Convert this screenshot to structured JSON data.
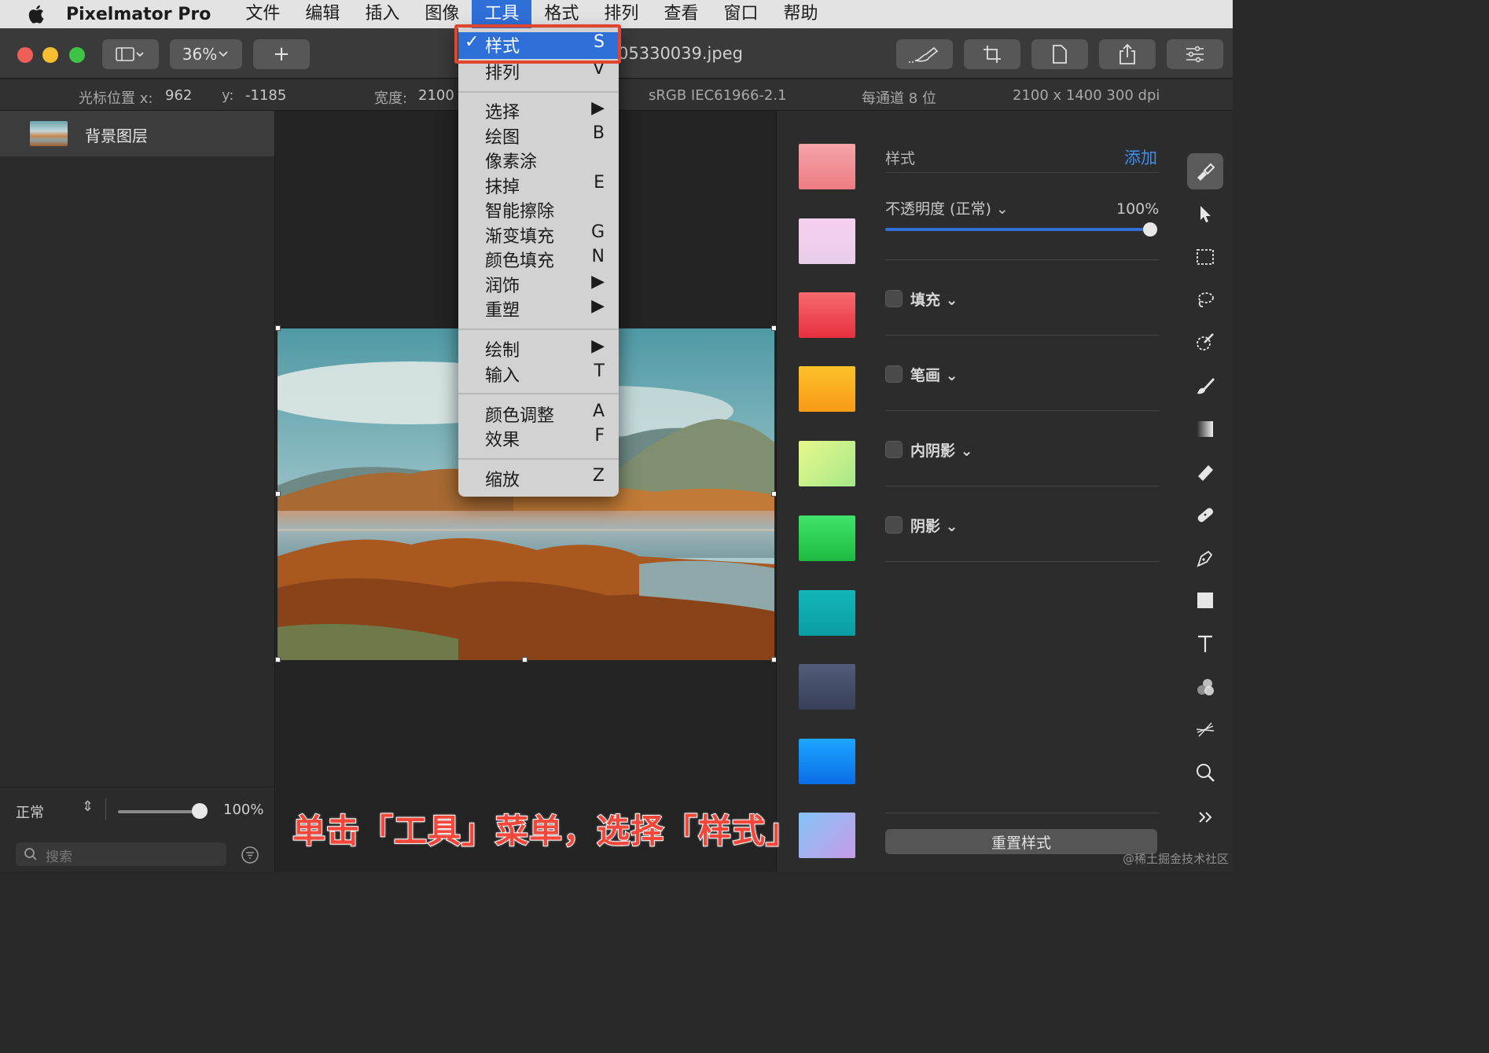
{
  "menubar": {
    "app_name": "Pixelmator Pro",
    "menus": [
      "文件",
      "编辑",
      "插入",
      "图像",
      "工具",
      "格式",
      "排列",
      "查看",
      "窗口",
      "帮助"
    ],
    "active_menu": "工具"
  },
  "toolbar": {
    "zoom": "36%",
    "add_label": "+",
    "doc_title": "05330039.jpeg"
  },
  "infobar": {
    "cursor_x_label": "光标位置 x:",
    "cursor_x": "962",
    "cursor_y_label": "y:",
    "cursor_y": "-1185",
    "width_label": "宽度:",
    "width": "2100",
    "colorspace": "sRGB IEC61966-2.1",
    "bitdepth": "每通道 8 位",
    "dimensions": "2100 x 1400 300 dpi"
  },
  "layers": {
    "items": [
      {
        "name": "背景图层"
      }
    ],
    "blend_mode": "正常",
    "opacity": "100%",
    "search_placeholder": "搜索"
  },
  "tools_menu": {
    "items": [
      {
        "label": "样式",
        "shortcut": "S",
        "checked": "✓"
      },
      {
        "label": "排列",
        "shortcut": "V"
      },
      {
        "label": "选择",
        "shortcut": "▶"
      },
      {
        "label": "绘图",
        "shortcut": "B"
      },
      {
        "label": "像素涂",
        "shortcut": ""
      },
      {
        "label": "抹掉",
        "shortcut": "E"
      },
      {
        "label": "智能擦除",
        "shortcut": ""
      },
      {
        "label": "渐变填充",
        "shortcut": "G"
      },
      {
        "label": "颜色填充",
        "shortcut": "N"
      },
      {
        "label": "润饰",
        "shortcut": "▶"
      },
      {
        "label": "重塑",
        "shortcut": "▶"
      },
      {
        "label": "绘制",
        "shortcut": "▶"
      },
      {
        "label": "输入",
        "shortcut": "T"
      },
      {
        "label": "颜色调整",
        "shortcut": "A"
      },
      {
        "label": "效果",
        "shortcut": "F"
      },
      {
        "label": "缩放",
        "shortcut": "Z"
      }
    ]
  },
  "styles_panel": {
    "title": "样式",
    "add_label": "添加",
    "opacity_label": "不透明度 (正常) ⌄",
    "opacity_value": "100%",
    "opacity_fraction": 1.0,
    "options": [
      {
        "label": "填充 ⌄"
      },
      {
        "label": "笔画 ⌄"
      },
      {
        "label": "内阴影 ⌄"
      },
      {
        "label": "阴影 ⌄"
      }
    ],
    "reset_label": "重置样式",
    "swatches": [
      {
        "from": "#f4a5a8",
        "to": "#ee7c83"
      },
      {
        "from": "#f5d0ef",
        "to": "#e9cde9"
      },
      {
        "from": "#f86a6f",
        "to": "#e62f3d"
      },
      {
        "from": "#ffc12a",
        "to": "#f79b16"
      },
      {
        "from": "#e7f88c",
        "to": "#a8e88a"
      },
      {
        "from": "#3fe46a",
        "to": "#1dbb3e"
      },
      {
        "from": "#12b5b8",
        "to": "#0b9ea3"
      },
      {
        "from": "#525c78",
        "to": "#384059"
      },
      {
        "from": "#1da6ff",
        "to": "#0a6de6"
      },
      {
        "from": "#84c4f8",
        "to": "#c79be6"
      }
    ]
  },
  "tool_icons": [
    "style-brush-icon",
    "arrow-icon",
    "rect-select-icon",
    "lasso-icon",
    "quick-select-icon",
    "paint-brush-icon",
    "gradient-icon",
    "eraser-icon",
    "bandage-icon",
    "pen-icon",
    "shape-icon",
    "type-icon",
    "color-adjust-icon",
    "effects-icon",
    "zoom-icon",
    "more-icon"
  ],
  "caption": "单击「工具」菜单，选择「样式」",
  "watermark": "@稀土掘金技术社区"
}
